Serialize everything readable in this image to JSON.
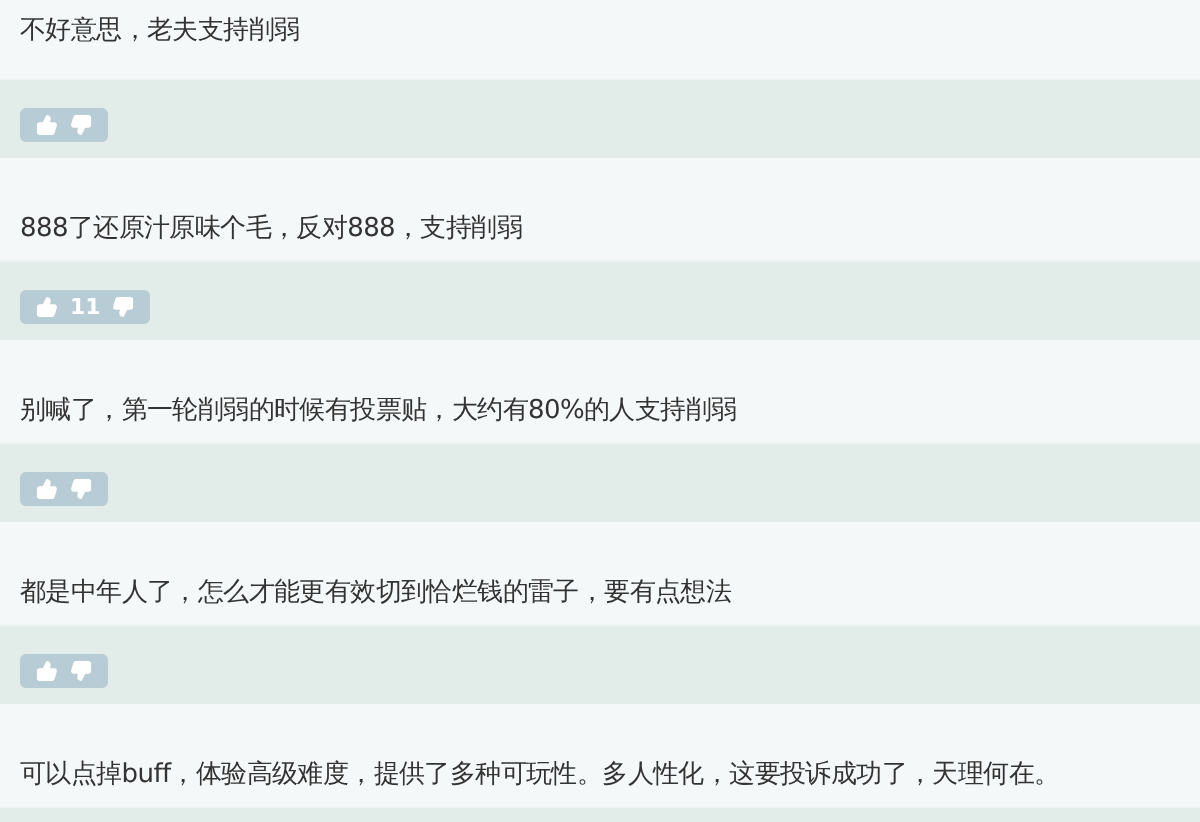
{
  "comments": [
    {
      "text": "不好意思，老夫支持削弱",
      "voting": true
    },
    {
      "text": "888了还原汁原味个毛，反对888，支持削弱",
      "voting": true,
      "votes": "11"
    },
    {
      "text": "别喊了，第一轮削弱的时候有投票贴，大约有80%的人支持削弱",
      "voting": true
    },
    {
      "text": "都是中年人了，怎么才能更有效切到恰烂钱的雷子，要有点想法",
      "voting": true
    },
    {
      "text": "可以点掉buff，体验高级难度，提供了多种可玩性。多人性化，这要投诉成功了，天理何在。"
    }
  ]
}
